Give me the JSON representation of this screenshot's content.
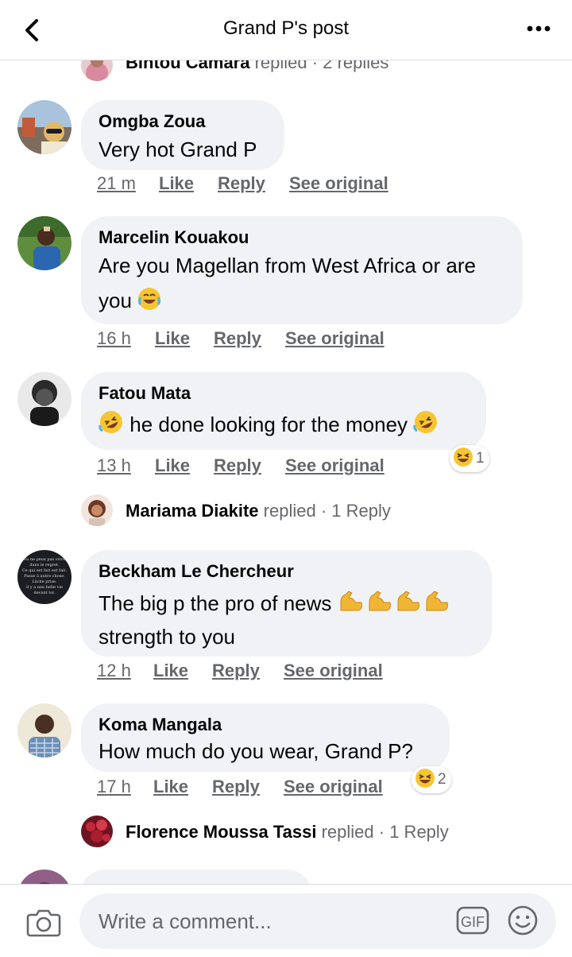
{
  "header": {
    "title": "Grand P's post"
  },
  "comments": [
    {
      "name": "Omgba Zoua",
      "text": "Very hot Grand P",
      "time": "21 m"
    },
    {
      "name": "Marcelin Kouakou",
      "text_line1": "Are you Magellan from West Africa or are",
      "text_line2": "you",
      "time": "16 h"
    },
    {
      "name": "Fatou Mata",
      "text": "he done looking for the money",
      "time": "13 h",
      "reaction_count": "1"
    },
    {
      "name": "Beckham Le Chercheur",
      "text_line1": "The big p the pro of news",
      "text_line2": "strength to you",
      "time": "12 h",
      "avatar_text": [
        "Tu ne peux pas vivre",
        "dans le regret.",
        "Ce qui est fait est fait.",
        "Passe à autre chose.",
        "Lâche prise.",
        "il y a une belle vie",
        "devant toi."
      ]
    },
    {
      "name": "Koma Mangala",
      "text": "How much do you wear, Grand P?",
      "time": "17 h",
      "reaction_count": "2"
    }
  ],
  "actions": {
    "like": "Like",
    "reply": "Reply",
    "see_original": "See original"
  },
  "replies": {
    "top_partial": {
      "name": "Bintou Camara",
      "verb": "replied",
      "sep": "·",
      "count": "2 replies"
    },
    "mariama": {
      "name": "Mariama Diakite",
      "verb": "replied",
      "sep": "·",
      "count": "1 Reply"
    },
    "florence": {
      "name": "Florence Moussa Tassi",
      "verb": "replied",
      "sep": "·",
      "count": "1 Reply"
    }
  },
  "composer": {
    "placeholder": "Write a comment...",
    "gif_label": "GIF"
  },
  "icons": {
    "back": "chevron-left-icon",
    "more": "more-dots-icon",
    "camera": "camera-icon",
    "gif": "gif-icon",
    "emoji": "smiley-icon"
  },
  "colors": {
    "bubble": "#f0f2f5",
    "text": "#050505",
    "secondary_text": "#65676b",
    "divider": "#dadde1"
  }
}
